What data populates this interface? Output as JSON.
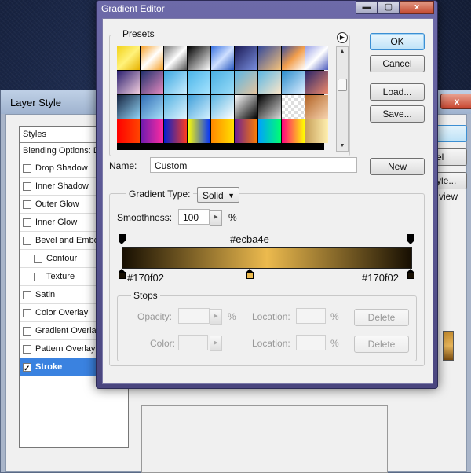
{
  "layer_style": {
    "title": "Layer Style",
    "list_header": "Styles",
    "blending_label": "Blending Options: D",
    "items": [
      {
        "label": "Drop Shadow",
        "checked": false,
        "sub": false
      },
      {
        "label": "Inner Shadow",
        "checked": false,
        "sub": false
      },
      {
        "label": "Outer Glow",
        "checked": false,
        "sub": false
      },
      {
        "label": "Inner Glow",
        "checked": false,
        "sub": false
      },
      {
        "label": "Bevel and Embos",
        "checked": false,
        "sub": false
      },
      {
        "label": "Contour",
        "checked": false,
        "sub": true
      },
      {
        "label": "Texture",
        "checked": false,
        "sub": true
      },
      {
        "label": "Satin",
        "checked": false,
        "sub": false
      },
      {
        "label": "Color Overlay",
        "checked": false,
        "sub": false
      },
      {
        "label": "Gradient Overlay",
        "checked": false,
        "sub": false
      },
      {
        "label": "Pattern Overlay",
        "checked": false,
        "sub": false
      },
      {
        "label": "Stroke",
        "checked": true,
        "sub": false,
        "selected": true
      }
    ],
    "right_buttons": [
      "el",
      "yle...",
      "view"
    ],
    "close_glyph": "x"
  },
  "gradient_editor": {
    "title": "Gradient Editor",
    "window_buttons": {
      "minimize": "▬",
      "maximize": "▢",
      "close": "x"
    },
    "presets_label": "Presets",
    "menu_icon_glyph": "▶",
    "presets": [
      "linear-gradient(135deg,#f2d21a,#fff27a,#e7b200)",
      "linear-gradient(135deg,#f6a028,#fff,#f6a028)",
      "linear-gradient(135deg,#777,#fff,#555)",
      "linear-gradient(135deg,#000,#fff)",
      "linear-gradient(135deg,#3b72e0,#cfe0ff,#2858c0)",
      "linear-gradient(135deg,#1b1b55,#7a8fe0)",
      "linear-gradient(135deg,#354a9a,#f6c37b)",
      "linear-gradient(135deg,#3d4f9b,#f29e4c,#fff)",
      "linear-gradient(135deg,#9ca3e6,#fff,#4c5bbd)",
      "linear-gradient(135deg,#2a1f6e,#f5d0e0)",
      "linear-gradient(135deg,#1d2f6b,#e88bc0)",
      "linear-gradient(135deg,#3ba7e0,#cbeeff)",
      "linear-gradient(135deg,#4ab4e8,#a8e4ff)",
      "linear-gradient(135deg,#49b0e3,#9adcf8)",
      "linear-gradient(135deg,#5bb6e4,#e8c49c)",
      "linear-gradient(135deg,#5bb6e4,#ffe7c8)",
      "linear-gradient(135deg,#2a8ccc,#dfefff)",
      "linear-gradient(135deg,#29256a,#f18b6a)",
      "linear-gradient(135deg,#16233f,#8fd2f5)",
      "linear-gradient(135deg,#2f6cb5,#a7dff8)",
      "linear-gradient(135deg,#53b1e2,#dff4ff)",
      "linear-gradient(135deg,#3f9fd9,#d4f1ff)",
      "linear-gradient(135deg,#5ab5e2,#fff)",
      "linear-gradient(135deg,#fff,#000)",
      "linear-gradient(135deg,#000,#d8d8d8)",
      "repeating-conic-gradient(#ddd 0 25%, #fff 0 50%) 0 0/8px 8px",
      "linear-gradient(135deg,#b36426,#f7d4b0)",
      "linear-gradient(90deg,#ff0000,#ff4400)",
      "linear-gradient(90deg,#6a1bb0,#ff2ba0)",
      "linear-gradient(90deg,#0020d0,#ff3a20)",
      "linear-gradient(90deg,#ff0,#0030ff)",
      "linear-gradient(90deg,#ff8800,#ffe000)",
      "linear-gradient(90deg,#6b1e96,#ff7f00)",
      "linear-gradient(90deg,#00a0ff,#00ff70)",
      "linear-gradient(90deg,#ff0080,#ffff00)",
      "linear-gradient(90deg,#c8a05a,#fff0b0)"
    ],
    "buttons": {
      "ok": "OK",
      "cancel": "Cancel",
      "load": "Load...",
      "save": "Save...",
      "new": "New"
    },
    "name_label": "Name:",
    "name_value": "Custom",
    "gradient_type_label": "Gradient Type:",
    "gradient_type_value": "Solid",
    "smoothness_label": "Smoothness:",
    "smoothness_value": "100",
    "percent": "%",
    "gradient": {
      "colors": [
        "#170f02",
        "#ecba4e",
        "#170f02"
      ],
      "mid_label": "#ecba4e",
      "left_label": "#170f02",
      "right_label": "#170f02",
      "midpoint_fraction": 0.5
    },
    "stops_label": "Stops",
    "opacity_label": "Opacity:",
    "color_label": "Color:",
    "location_label": "Location:",
    "delete_label": "Delete"
  }
}
